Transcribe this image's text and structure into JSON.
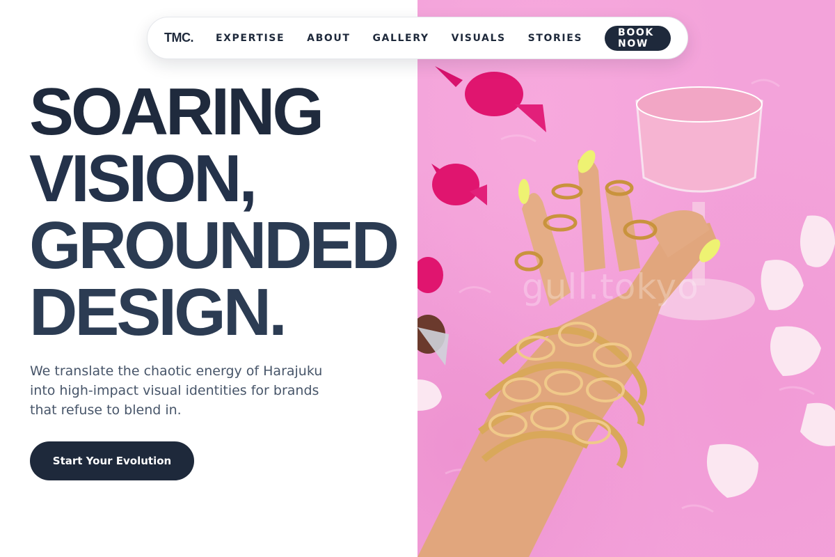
{
  "nav": {
    "logo": "TMC.",
    "links": [
      "EXPERTISE",
      "ABOUT",
      "GALLERY",
      "VISUALS",
      "STORIES"
    ],
    "cta": "BOOK NOW"
  },
  "hero": {
    "headline": [
      "SOARING",
      "VISION,",
      "GROUNDED",
      "DESIGN."
    ],
    "subtitle": "We translate the chaotic energy of Harajuku into high-impact visual identities for brands that refuse to blend in.",
    "cta": "Start Your Evolution",
    "image_watermark": "gull.tokyo"
  },
  "colors": {
    "navy": "#1e293b",
    "body_text": "#475569",
    "pink_background": "#f3a3da"
  }
}
